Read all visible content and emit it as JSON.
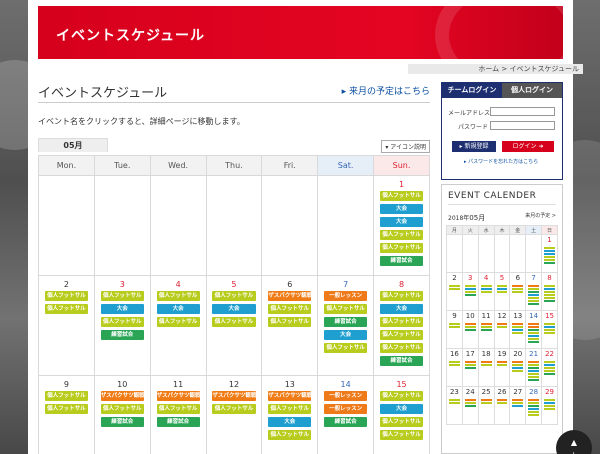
{
  "header": {
    "title": "イベントスケジュール",
    "breadcrumb": "ホーム > イベントスケジュール"
  },
  "main": {
    "title": "イベントスケジュール",
    "next_month_link": "来月の予定はこちら",
    "intro": "イベント名をクリックすると、詳細ページに移動します。",
    "icon_legend_button": "アイコン説明",
    "month_tab": "05月",
    "weekdays": [
      "Mon.",
      "Tue.",
      "Wed.",
      "Thu.",
      "Fri.",
      "Sat.",
      "Sun."
    ],
    "weeks": [
      [
        {
          "day": "",
          "events": []
        },
        {
          "day": "",
          "events": []
        },
        {
          "day": "",
          "events": []
        },
        {
          "day": "",
          "events": []
        },
        {
          "day": "",
          "events": []
        },
        {
          "day": "",
          "events": []
        },
        {
          "day": "1",
          "color": "red",
          "events": [
            {
              "label": "個人フットサル",
              "type": "personal"
            },
            {
              "label": "大会",
              "type": "tournament"
            },
            {
              "label": "大会",
              "type": "tournament"
            },
            {
              "label": "個人フットサル",
              "type": "personal"
            },
            {
              "label": "個人フットサル",
              "type": "personal"
            },
            {
              "label": "練習試合",
              "type": "practice"
            }
          ]
        }
      ],
      [
        {
          "day": "2",
          "color": "",
          "events": [
            {
              "label": "個人フットサル",
              "type": "personal"
            },
            {
              "label": "個人フットサル",
              "type": "personal"
            }
          ]
        },
        {
          "day": "3",
          "color": "red",
          "events": [
            {
              "label": "個人フットサル",
              "type": "personal"
            },
            {
              "label": "大会",
              "type": "tournament"
            },
            {
              "label": "個人フットサル",
              "type": "personal"
            },
            {
              "label": "練習試合",
              "type": "practice"
            }
          ]
        },
        {
          "day": "4",
          "color": "red",
          "events": [
            {
              "label": "個人フットサル",
              "type": "personal"
            },
            {
              "label": "大会",
              "type": "tournament"
            },
            {
              "label": "個人フットサル",
              "type": "personal"
            }
          ]
        },
        {
          "day": "5",
          "color": "red",
          "events": [
            {
              "label": "個人フットサル",
              "type": "personal"
            },
            {
              "label": "大会",
              "type": "tournament"
            },
            {
              "label": "個人フットサル",
              "type": "personal"
            }
          ]
        },
        {
          "day": "6",
          "color": "",
          "events": [
            {
              "label": "ザスパクサツ観戦",
              "type": "school"
            },
            {
              "label": "個人フットサル",
              "type": "personal"
            },
            {
              "label": "個人フットサル",
              "type": "personal"
            }
          ]
        },
        {
          "day": "7",
          "color": "blue",
          "events": [
            {
              "label": "一般レッスン",
              "type": "lesson"
            },
            {
              "label": "個人フットサル",
              "type": "personal"
            },
            {
              "label": "練習試合",
              "type": "practice"
            },
            {
              "label": "大会",
              "type": "tournament"
            },
            {
              "label": "個人フットサル",
              "type": "personal"
            }
          ]
        },
        {
          "day": "8",
          "color": "red",
          "events": [
            {
              "label": "個人フットサル",
              "type": "personal"
            },
            {
              "label": "大会",
              "type": "tournament"
            },
            {
              "label": "個人フットサル",
              "type": "personal"
            },
            {
              "label": "個人フットサル",
              "type": "personal"
            },
            {
              "label": "個人フットサル",
              "type": "personal"
            },
            {
              "label": "練習試合",
              "type": "practice"
            }
          ]
        }
      ],
      [
        {
          "day": "9",
          "color": "",
          "events": [
            {
              "label": "個人フットサル",
              "type": "personal"
            },
            {
              "label": "個人フットサル",
              "type": "personal"
            }
          ]
        },
        {
          "day": "10",
          "color": "",
          "events": [
            {
              "label": "ザスパクサツ観戦",
              "type": "school"
            },
            {
              "label": "個人フットサル",
              "type": "personal"
            },
            {
              "label": "練習試合",
              "type": "practice"
            }
          ]
        },
        {
          "day": "11",
          "color": "",
          "events": [
            {
              "label": "ザスパクサツ観戦",
              "type": "school"
            },
            {
              "label": "個人フットサル",
              "type": "personal"
            },
            {
              "label": "練習試合",
              "type": "practice"
            }
          ]
        },
        {
          "day": "12",
          "color": "",
          "events": [
            {
              "label": "ザスパクサツ観戦",
              "type": "school"
            },
            {
              "label": "個人フットサル",
              "type": "personal"
            }
          ]
        },
        {
          "day": "13",
          "color": "",
          "events": [
            {
              "label": "ザスパクサツ観戦",
              "type": "school"
            },
            {
              "label": "個人フットサル",
              "type": "personal"
            },
            {
              "label": "大会",
              "type": "tournament"
            },
            {
              "label": "個人フットサル",
              "type": "personal"
            }
          ]
        },
        {
          "day": "14",
          "color": "blue",
          "events": [
            {
              "label": "一般レッスン",
              "type": "lesson"
            },
            {
              "label": "一般レッスン",
              "type": "lesson"
            },
            {
              "label": "練習試合",
              "type": "practice"
            }
          ]
        },
        {
          "day": "15",
          "color": "red",
          "events": [
            {
              "label": "個人フットサル",
              "type": "personal"
            },
            {
              "label": "大会",
              "type": "tournament"
            },
            {
              "label": "個人フットサル",
              "type": "personal"
            },
            {
              "label": "個人フットサル",
              "type": "personal"
            }
          ]
        }
      ]
    ]
  },
  "login": {
    "tab_team": "チームログイン",
    "tab_individual": "個人ログイン",
    "mail_label": "メールアドレス",
    "password_label": "パスワード",
    "register_button": "新規登録",
    "login_button": "ログイン",
    "forgot_link": "パスワードを忘れた方はこちら"
  },
  "event_calendar": {
    "title": "EVENT CALENDER",
    "year": "2018年",
    "month": "05月",
    "next_link": "来月の予定 >",
    "weekdays": [
      "月",
      "火",
      "水",
      "木",
      "金",
      "土",
      "日"
    ],
    "weeks": [
      [
        {
          "day": "",
          "bars": []
        },
        {
          "day": "",
          "bars": []
        },
        {
          "day": "",
          "bars": []
        },
        {
          "day": "",
          "bars": []
        },
        {
          "day": "",
          "bars": []
        },
        {
          "day": "",
          "bars": []
        },
        {
          "day": "1",
          "color": "red",
          "bars": [
            "y",
            "b",
            "b",
            "y",
            "y",
            "g"
          ]
        }
      ],
      [
        {
          "day": "2",
          "color": "",
          "bars": [
            "y",
            "y"
          ]
        },
        {
          "day": "3",
          "color": "red",
          "bars": [
            "y",
            "b",
            "y",
            "g"
          ]
        },
        {
          "day": "4",
          "color": "red",
          "bars": [
            "y",
            "b",
            "y"
          ]
        },
        {
          "day": "5",
          "color": "red",
          "bars": [
            "y",
            "b",
            "y"
          ]
        },
        {
          "day": "6",
          "color": "",
          "bars": [
            "o",
            "y",
            "y"
          ]
        },
        {
          "day": "7",
          "color": "blue",
          "bars": [
            "o",
            "y",
            "g",
            "b",
            "y",
            "y",
            "g"
          ]
        },
        {
          "day": "8",
          "color": "red",
          "bars": [
            "y",
            "b",
            "y",
            "y",
            "y",
            "g"
          ]
        }
      ],
      [
        {
          "day": "9",
          "color": "",
          "bars": [
            "y",
            "y"
          ]
        },
        {
          "day": "10",
          "color": "",
          "bars": [
            "o",
            "y",
            "g"
          ]
        },
        {
          "day": "11",
          "color": "",
          "bars": [
            "o",
            "y",
            "g"
          ]
        },
        {
          "day": "12",
          "color": "",
          "bars": [
            "o",
            "y"
          ]
        },
        {
          "day": "13",
          "color": "",
          "bars": [
            "o",
            "y",
            "b",
            "y"
          ]
        },
        {
          "day": "14",
          "color": "blue",
          "bars": [
            "o",
            "o",
            "g",
            "y",
            "b",
            "y",
            "g"
          ]
        },
        {
          "day": "15",
          "color": "red",
          "bars": [
            "y",
            "b",
            "y",
            "y"
          ]
        }
      ],
      [
        {
          "day": "16",
          "color": "",
          "bars": [
            "y",
            "y"
          ]
        },
        {
          "day": "17",
          "color": "",
          "bars": [
            "o",
            "y",
            "g"
          ]
        },
        {
          "day": "18",
          "color": "",
          "bars": [
            "o",
            "y"
          ]
        },
        {
          "day": "19",
          "color": "",
          "bars": [
            "o",
            "y"
          ]
        },
        {
          "day": "20",
          "color": "",
          "bars": [
            "o",
            "y",
            "b",
            "y"
          ]
        },
        {
          "day": "21",
          "color": "blue",
          "bars": [
            "o",
            "y",
            "g",
            "b",
            "y",
            "y",
            "g"
          ]
        },
        {
          "day": "22",
          "color": "red",
          "bars": [
            "y",
            "b",
            "y",
            "y",
            "g"
          ]
        }
      ],
      [
        {
          "day": "23",
          "color": "",
          "bars": [
            "y",
            "y"
          ]
        },
        {
          "day": "24",
          "color": "",
          "bars": [
            "o",
            "y",
            "g"
          ]
        },
        {
          "day": "25",
          "color": "",
          "bars": [
            "o",
            "y"
          ]
        },
        {
          "day": "26",
          "color": "",
          "bars": [
            "o",
            "y"
          ]
        },
        {
          "day": "27",
          "color": "",
          "bars": [
            "o",
            "y",
            "b"
          ]
        },
        {
          "day": "28",
          "color": "blue",
          "bars": [
            "o",
            "y",
            "g",
            "b",
            "y",
            "y"
          ]
        },
        {
          "day": "29",
          "color": "red",
          "bars": [
            "y",
            "b",
            "y",
            "y"
          ]
        }
      ]
    ]
  },
  "page_top": "上"
}
